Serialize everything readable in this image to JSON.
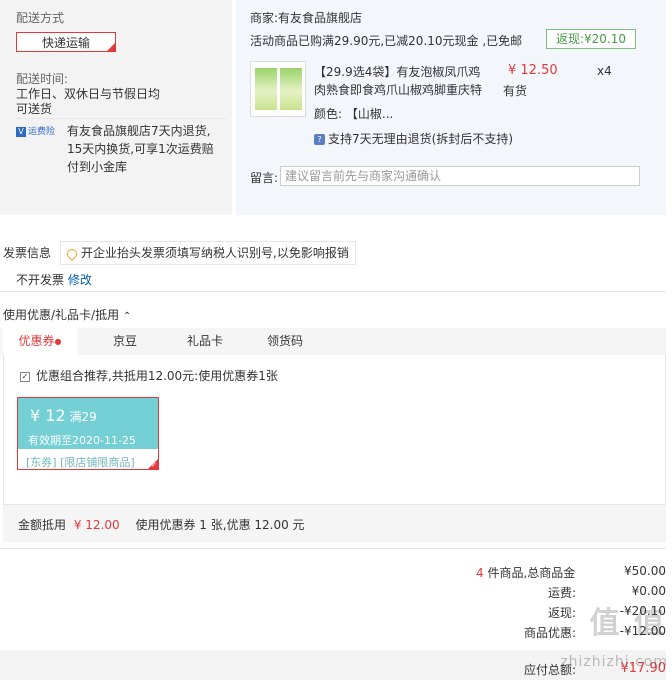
{
  "shipping": {
    "title": "配送方式",
    "method": "快递运输",
    "time_label": "配送时间:",
    "time_value_1": "工作日、双休日与节假日均",
    "time_value_2": "可送货",
    "insurance_badge": "运费险",
    "insurance_line_1": "有友食品旗舰店7天内退货,",
    "insurance_line_2": "15天内换货,可享1次运费赔",
    "insurance_line_3": "付到小金库"
  },
  "shop": {
    "merchant": "商家:有友食品旗舰店",
    "promo": "活动商品已购满29.90元,已减20.10元现金 ,已免邮",
    "rebate": "返现:¥20.10",
    "product_title_1": "【29.9选4袋】有友泡椒凤爪鸡",
    "product_title_2": "肉熟食即食鸡爪山椒鸡脚重庆特",
    "price": "¥ 12.50",
    "qty": "x4",
    "stock": "有货",
    "color_label": "颜色:",
    "color_value": "【山椒...",
    "return_policy": "支持7天无理由退货(拆封后不支持)",
    "note_label": "留言:",
    "note_placeholder": "建议留言前先与商家沟通确认"
  },
  "invoice": {
    "title": "发票信息",
    "tip": "开企业抬头发票须填写纳税人识别号,以免影响报销",
    "value": "不开发票",
    "edit": "修改"
  },
  "discount": {
    "title": "使用优惠/礼品卡/抵用",
    "tabs": [
      "优惠券",
      "京豆",
      "礼品卡",
      "领货码"
    ],
    "recommend": "优惠组合推荐,共抵用12.00元:使用优惠券1张",
    "coupon_amount": "¥ 12",
    "coupon_condition": "满29",
    "coupon_expiry": "有效期至2020-11-25",
    "coupon_tags": "[东券] [限店铺限商品]",
    "amount_label": "金额抵用",
    "amount_value": "¥ 12.00",
    "used_summary": "使用优惠券 1 张,优惠 12.00 元"
  },
  "totals": {
    "count": "4",
    "count_label": "件商品,总商品金",
    "goods_amount": "¥50.00",
    "shipping_label": "运费:",
    "shipping_value": "¥0.00",
    "discount_label": "返现:",
    "discount_value": "-¥20.10",
    "coupon_label": "商品优惠:",
    "coupon_value": "-¥12.00",
    "payable_label": "应付总额:",
    "payable_value": "¥17.90",
    "watermark": "值 值",
    "watermark_site": "zhizhizhi.com"
  },
  "colors": {
    "accent_red": "#e4393c",
    "coupon_teal": "#74d0d4",
    "link_blue": "#005ea7"
  }
}
